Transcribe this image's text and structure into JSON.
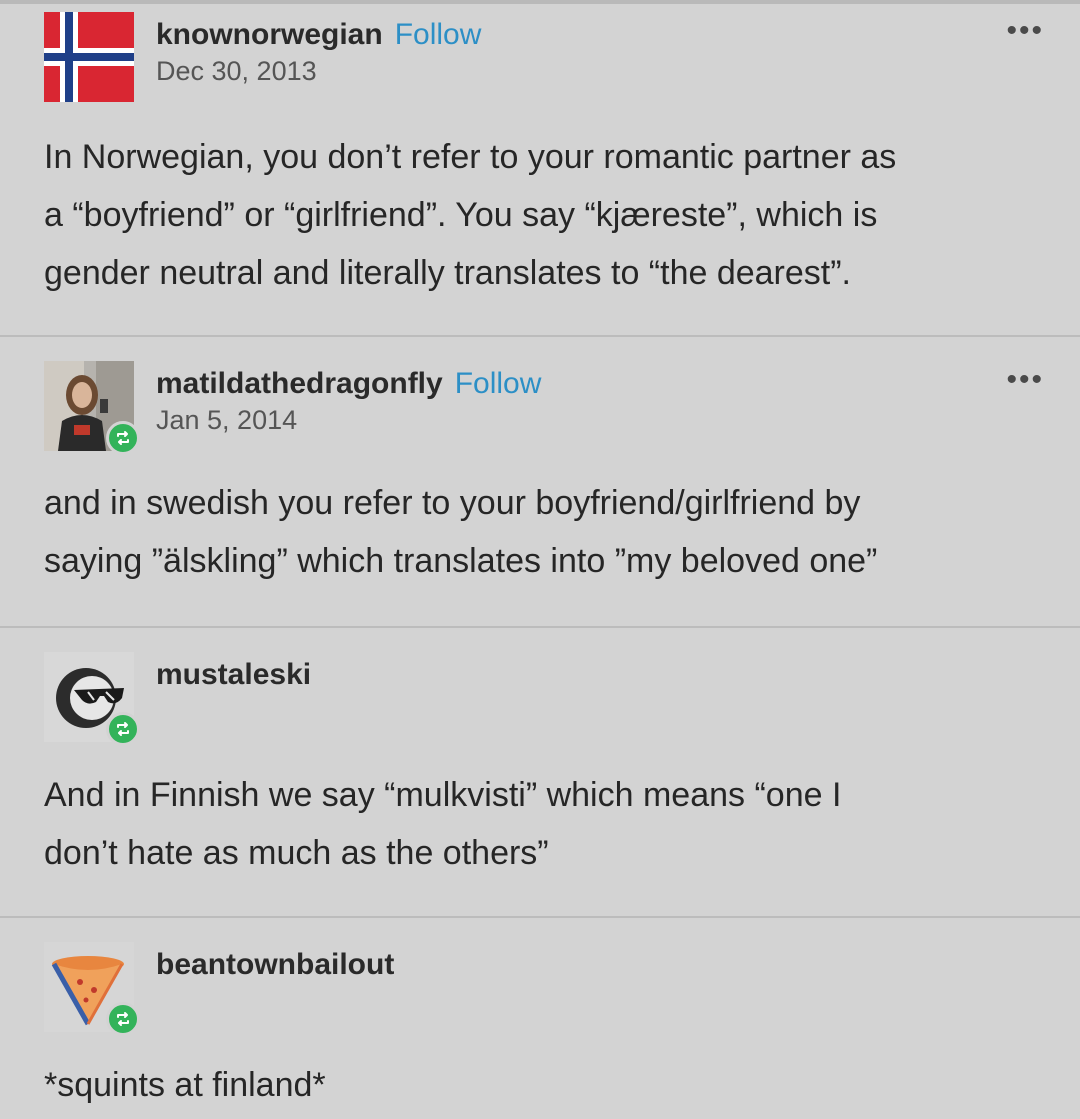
{
  "posts": [
    {
      "username": "knownorwegian",
      "follow": "Follow",
      "date": "Dec 30, 2013",
      "more": "•••",
      "lines": [
        "In Norwegian, you don’t refer to your romantic partner as",
        "a “boyfriend” or “girlfriend”. You say “kjæreste”, which is",
        "gender neutral and literally translates to “the dearest”."
      ]
    },
    {
      "username": "matildathedragonfly",
      "follow": "Follow",
      "date": "Jan 5, 2014",
      "more": "•••",
      "lines": [
        "and in swedish you refer to your boyfriend/girlfriend by",
        "saying ”älskling” which translates into ”my beloved one”"
      ]
    },
    {
      "username": "mustaleski",
      "lines": [
        "And in Finnish we say “mulkvisti” which means “one I",
        "don’t hate as much as the others”"
      ]
    },
    {
      "username": "beantownbailout",
      "lines": [
        "*squints at finland*"
      ]
    }
  ],
  "icons": {
    "avatar_1": "norway-flag-icon",
    "avatar_2": "user-photo-avatar",
    "avatar_3": "sunglasses-face-icon",
    "avatar_4": "pizza-slice-icon",
    "reblog": "reblog-icon"
  },
  "colors": {
    "background": "#d3d3d3",
    "follow": "#2c8fc6",
    "reblog_badge": "#33b35a",
    "flag_red": "#d92632",
    "flag_blue": "#1f3f88"
  }
}
